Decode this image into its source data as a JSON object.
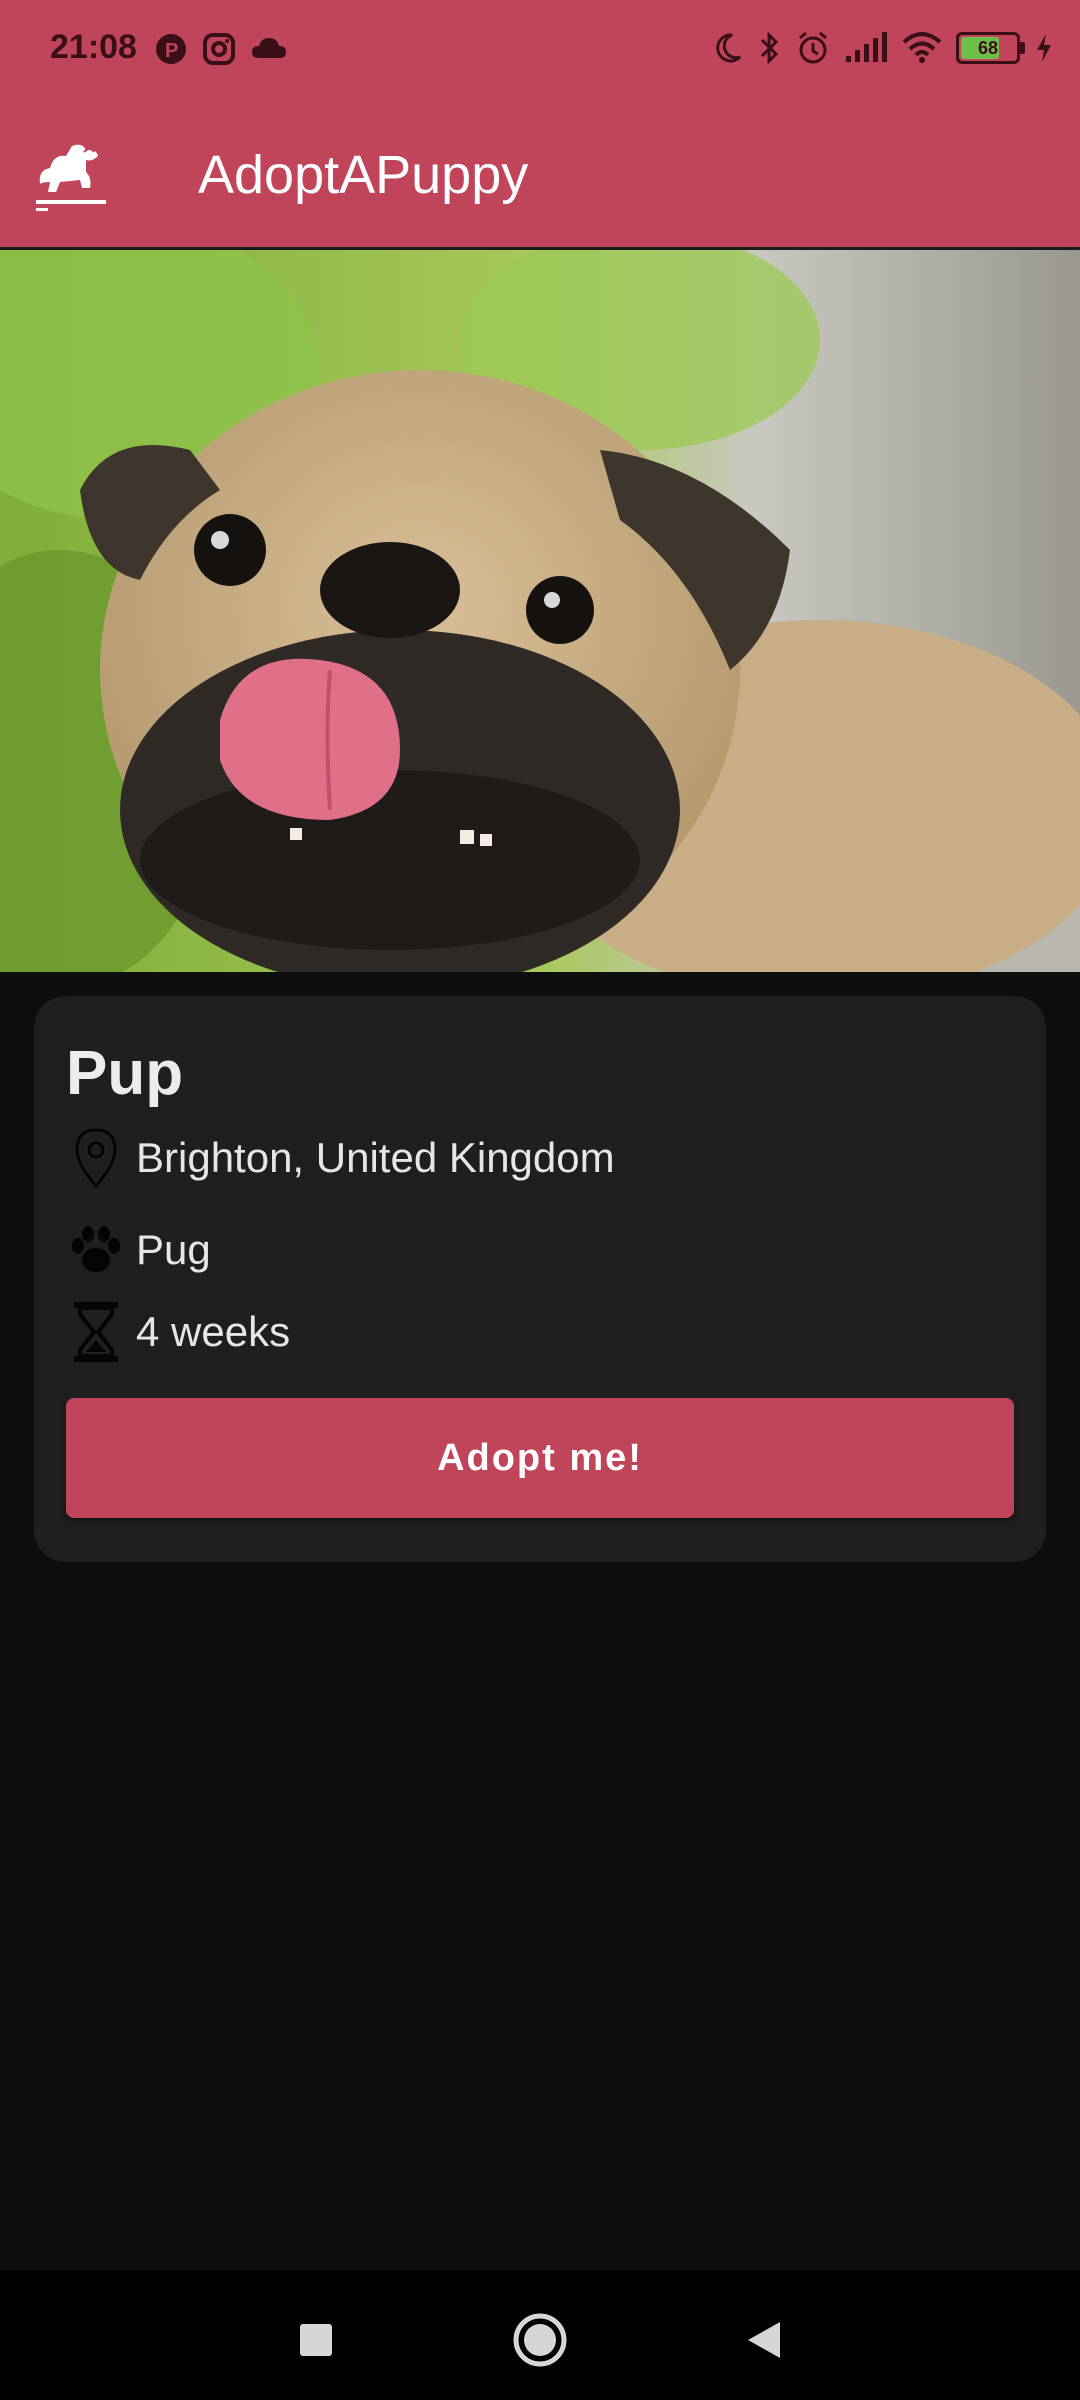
{
  "status_bar": {
    "time": "21:08",
    "battery_level": "68",
    "left_icons": [
      "app-p-icon",
      "instagram-icon",
      "cloud-icon"
    ],
    "right_icons": [
      "moon-icon",
      "bluetooth-icon",
      "alarm-icon",
      "signal-icon",
      "wifi-icon",
      "battery-icon",
      "charging-icon"
    ]
  },
  "app_bar": {
    "title": "AdoptAPuppy",
    "logo_icon": "dog-logo-icon"
  },
  "hero_image": {
    "subject": "pug puppy photo"
  },
  "pet": {
    "name": "Pup",
    "location": "Brighton, United Kingdom",
    "breed": "Pug",
    "age": "4 weeks",
    "location_icon": "location-pin-icon",
    "breed_icon": "paw-icon",
    "age_icon": "hourglass-icon"
  },
  "actions": {
    "adopt_label": "Adopt me!"
  },
  "colors": {
    "primary": "#c0455b",
    "background": "#0e0e0e",
    "card": "#1f1f20"
  },
  "nav_bar": {
    "buttons": [
      "recents-square-icon",
      "home-circle-icon",
      "back-triangle-icon"
    ]
  }
}
